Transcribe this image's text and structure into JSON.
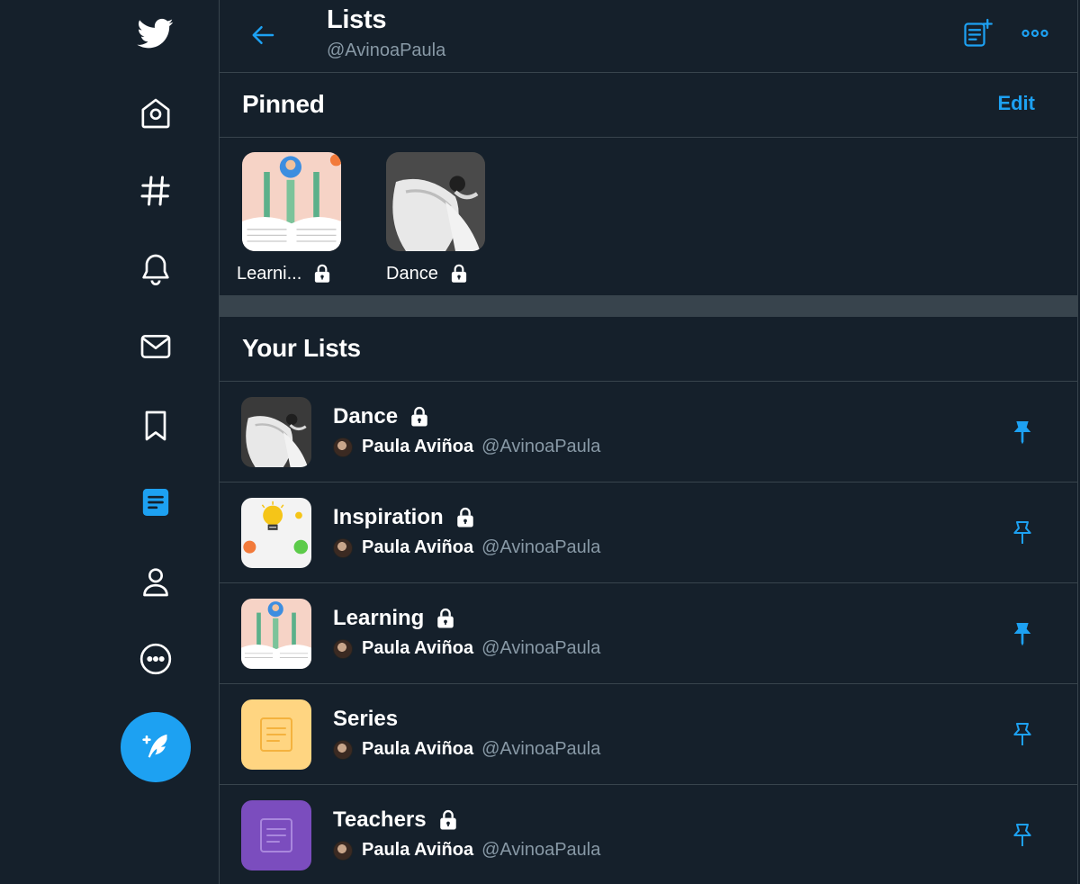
{
  "app": {
    "accent": "#1da1f2",
    "background": "#15202b",
    "border": "#38444d"
  },
  "nav": {
    "items": [
      {
        "name": "twitter-logo-icon"
      },
      {
        "name": "home-icon"
      },
      {
        "name": "explore-hashtag-icon"
      },
      {
        "name": "notifications-bell-icon"
      },
      {
        "name": "messages-envelope-icon"
      },
      {
        "name": "bookmarks-icon"
      },
      {
        "name": "lists-icon",
        "active": true
      },
      {
        "name": "profile-person-icon"
      },
      {
        "name": "more-circle-icon"
      }
    ],
    "tweet_button": "compose-tweet-icon"
  },
  "header": {
    "title": "Lists",
    "handle": "@AvinoaPaula",
    "icons": [
      "back-arrow-icon",
      "create-list-icon",
      "more-icon"
    ]
  },
  "pinned": {
    "title": "Pinned",
    "edit_label": "Edit",
    "items": [
      {
        "label": "Learni...",
        "locked": true,
        "thumb": "learning"
      },
      {
        "label": "Dance",
        "locked": true,
        "thumb": "dance"
      }
    ]
  },
  "your_lists": {
    "title": "Your Lists",
    "items": [
      {
        "name": "Dance",
        "locked": true,
        "thumb": "dance",
        "owner": "Paula Aviñoa",
        "handle": "@AvinoaPaula",
        "pinned": true
      },
      {
        "name": "Inspiration",
        "locked": true,
        "thumb": "inspiration",
        "owner": "Paula Aviñoa",
        "handle": "@AvinoaPaula",
        "pinned": false
      },
      {
        "name": "Learning",
        "locked": true,
        "thumb": "learning",
        "owner": "Paula Aviñoa",
        "handle": "@AvinoaPaula",
        "pinned": true
      },
      {
        "name": "Series",
        "locked": false,
        "thumb": "series",
        "owner": "Paula Aviñoa",
        "handle": "@AvinoaPaula",
        "pinned": false
      },
      {
        "name": "Teachers",
        "locked": true,
        "thumb": "teachers",
        "owner": "Paula Aviñoa",
        "handle": "@AvinoaPaula",
        "pinned": false
      }
    ]
  }
}
